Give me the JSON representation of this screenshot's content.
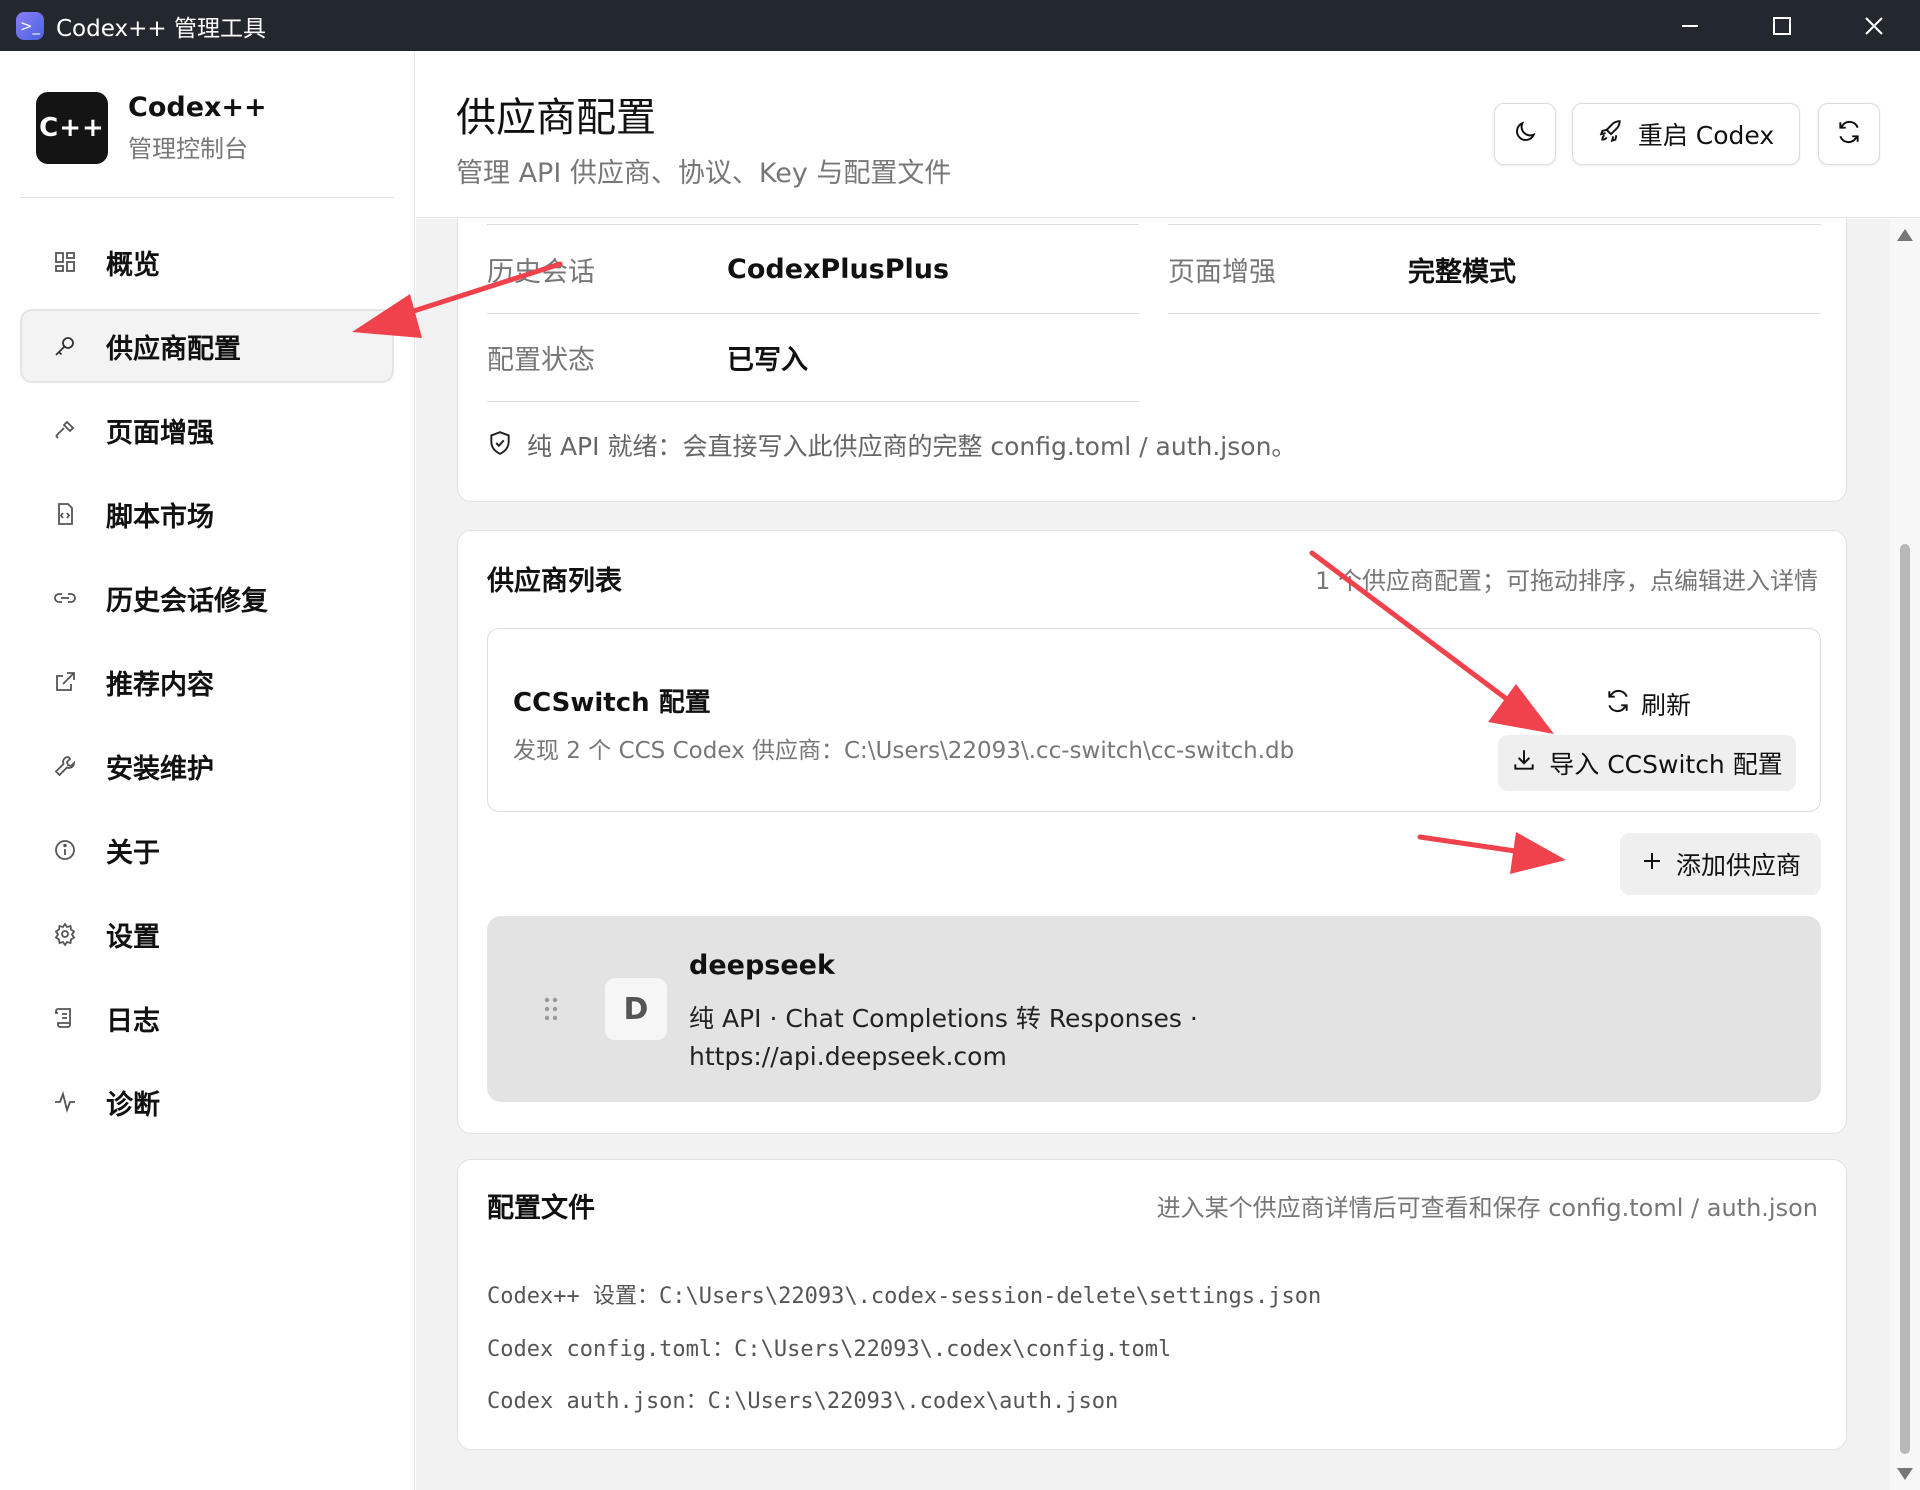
{
  "window": {
    "title": "Codex++ 管理工具"
  },
  "brand": {
    "logo": "C++",
    "name": "Codex++",
    "subtitle": "管理控制台"
  },
  "sidebar": {
    "items": [
      {
        "label": "概览",
        "icon": "grid-icon"
      },
      {
        "label": "供应商配置",
        "icon": "key-icon",
        "active": true
      },
      {
        "label": "页面增强",
        "icon": "hammer-icon"
      },
      {
        "label": "脚本市场",
        "icon": "script-file-icon"
      },
      {
        "label": "历史会话修复",
        "icon": "link-icon"
      },
      {
        "label": "推荐内容",
        "icon": "external-link-icon"
      },
      {
        "label": "安装维护",
        "icon": "wrench-icon"
      },
      {
        "label": "关于",
        "icon": "info-icon"
      },
      {
        "label": "设置",
        "icon": "gear-icon"
      },
      {
        "label": "日志",
        "icon": "scroll-icon"
      },
      {
        "label": "诊断",
        "icon": "activity-icon"
      }
    ]
  },
  "header": {
    "title": "供应商配置",
    "subtitle": "管理 API 供应商、协议、Key 与配置文件",
    "restart_label": "重启 Codex"
  },
  "status_card": {
    "rows": [
      {
        "key": "历史会话",
        "value": "CodexPlusPlus"
      },
      {
        "key": "页面增强",
        "value": "完整模式"
      },
      {
        "key": "配置状态",
        "value": "已写入"
      }
    ],
    "note": "纯 API 就绪：会直接写入此供应商的完整 config.toml / auth.json。"
  },
  "provider_list": {
    "title": "供应商列表",
    "note": "1 个供应商配置；可拖动排序，点编辑进入详情",
    "ccswitch": {
      "title": "CCSwitch 配置",
      "desc": "发现 2 个 CCS Codex 供应商：C:\\Users\\22093\\.cc-switch\\cc-switch.db",
      "refresh_label": "刷新",
      "import_label": "导入 CCSwitch 配置"
    },
    "add_label": "添加供应商",
    "providers": [
      {
        "initial": "D",
        "name": "deepseek",
        "desc_line1": "纯 API · Chat Completions 转 Responses ·",
        "desc_line2": "https://api.deepseek.com"
      }
    ]
  },
  "config_files": {
    "title": "配置文件",
    "note": "进入某个供应商详情后可查看和保存 config.toml / auth.json",
    "lines": [
      "Codex++ 设置：C:\\Users\\22093\\.codex-session-delete\\settings.json",
      "Codex config.toml：C:\\Users\\22093\\.codex\\config.toml",
      "Codex auth.json：C:\\Users\\22093\\.codex\\auth.json"
    ]
  },
  "colors": {
    "annotation_arrow": "#f0424c",
    "title_bar": "#23282e",
    "content_bg": "#f2f2f2"
  }
}
